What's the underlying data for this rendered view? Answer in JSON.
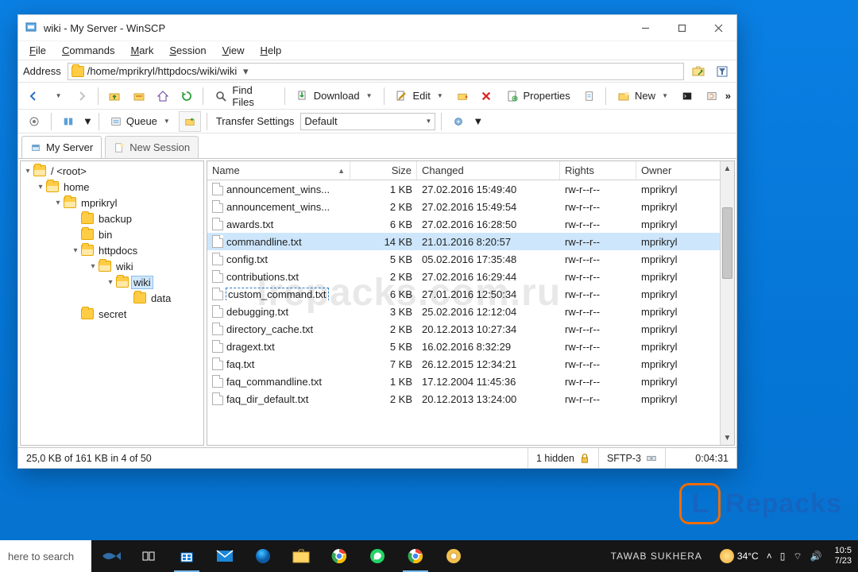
{
  "window": {
    "title": "wiki - My Server - WinSCP"
  },
  "menubar": [
    "File",
    "Commands",
    "Mark",
    "Session",
    "View",
    "Help"
  ],
  "addressbar": {
    "label": "Address",
    "path": "/home/mprikryl/httpdocs/wiki/wiki"
  },
  "toolbar": {
    "find": "Find Files",
    "download": "Download",
    "edit": "Edit",
    "properties": "Properties",
    "new": "New"
  },
  "toolbar2": {
    "queue": "Queue",
    "transfer_label": "Transfer Settings",
    "transfer_value": "Default"
  },
  "tabs": {
    "active": "My Server",
    "new": "New Session"
  },
  "tree": {
    "root": {
      "label": "/ <root>"
    },
    "home": {
      "label": "home"
    },
    "mprikryl": {
      "label": "mprikryl"
    },
    "backup": {
      "label": "backup"
    },
    "bin": {
      "label": "bin"
    },
    "httpdocs": {
      "label": "httpdocs"
    },
    "wiki1": {
      "label": "wiki"
    },
    "wiki2": {
      "label": "wiki"
    },
    "data": {
      "label": "data"
    },
    "secret": {
      "label": "secret"
    },
    "selected": "wiki2"
  },
  "columns": {
    "name": "Name",
    "size": "Size",
    "changed": "Changed",
    "rights": "Rights",
    "owner": "Owner"
  },
  "files": [
    {
      "name": "announcement_wins...",
      "size": "1 KB",
      "changed": "27.02.2016 15:49:40",
      "rights": "rw-r--r--",
      "owner": "mprikryl"
    },
    {
      "name": "announcement_wins...",
      "size": "2 KB",
      "changed": "27.02.2016 15:49:54",
      "rights": "rw-r--r--",
      "owner": "mprikryl"
    },
    {
      "name": "awards.txt",
      "size": "6 KB",
      "changed": "27.02.2016 16:28:50",
      "rights": "rw-r--r--",
      "owner": "mprikryl"
    },
    {
      "name": "commandline.txt",
      "size": "14 KB",
      "changed": "21.01.2016 8:20:57",
      "rights": "rw-r--r--",
      "owner": "mprikryl",
      "selected": true
    },
    {
      "name": "config.txt",
      "size": "5 KB",
      "changed": "05.02.2016 17:35:48",
      "rights": "rw-r--r--",
      "owner": "mprikryl"
    },
    {
      "name": "contributions.txt",
      "size": "2 KB",
      "changed": "27.02.2016 16:29:44",
      "rights": "rw-r--r--",
      "owner": "mprikryl"
    },
    {
      "name": "custom_command.txt",
      "size": "6 KB",
      "changed": "27.01.2016 12:50:34",
      "rights": "rw-r--r--",
      "owner": "mprikryl",
      "renaming": true
    },
    {
      "name": "debugging.txt",
      "size": "3 KB",
      "changed": "25.02.2016 12:12:04",
      "rights": "rw-r--r--",
      "owner": "mprikryl"
    },
    {
      "name": "directory_cache.txt",
      "size": "2 KB",
      "changed": "20.12.2013 10:27:34",
      "rights": "rw-r--r--",
      "owner": "mprikryl"
    },
    {
      "name": "dragext.txt",
      "size": "5 KB",
      "changed": "16.02.2016 8:32:29",
      "rights": "rw-r--r--",
      "owner": "mprikryl"
    },
    {
      "name": "faq.txt",
      "size": "7 KB",
      "changed": "26.12.2015 12:34:21",
      "rights": "rw-r--r--",
      "owner": "mprikryl"
    },
    {
      "name": "faq_commandline.txt",
      "size": "1 KB",
      "changed": "17.12.2004 11:45:36",
      "rights": "rw-r--r--",
      "owner": "mprikryl"
    },
    {
      "name": "faq_dir_default.txt",
      "size": "2 KB",
      "changed": "20.12.2013 13:24:00",
      "rights": "rw-r--r--",
      "owner": "mprikryl"
    }
  ],
  "statusbar": {
    "selection": "25,0 KB of 161 KB in 4 of 50",
    "hidden": "1 hidden",
    "protocol": "SFTP-3",
    "elapsed": "0:04:31"
  },
  "watermark": "lrepacks.com.ru",
  "repacks": {
    "letter": "L",
    "word": "Repacks"
  },
  "taskbar": {
    "search_placeholder": "here to search",
    "user": "TAWAB SUKHERA",
    "weather": "34°C",
    "time": "10:5",
    "date": "7/23"
  }
}
